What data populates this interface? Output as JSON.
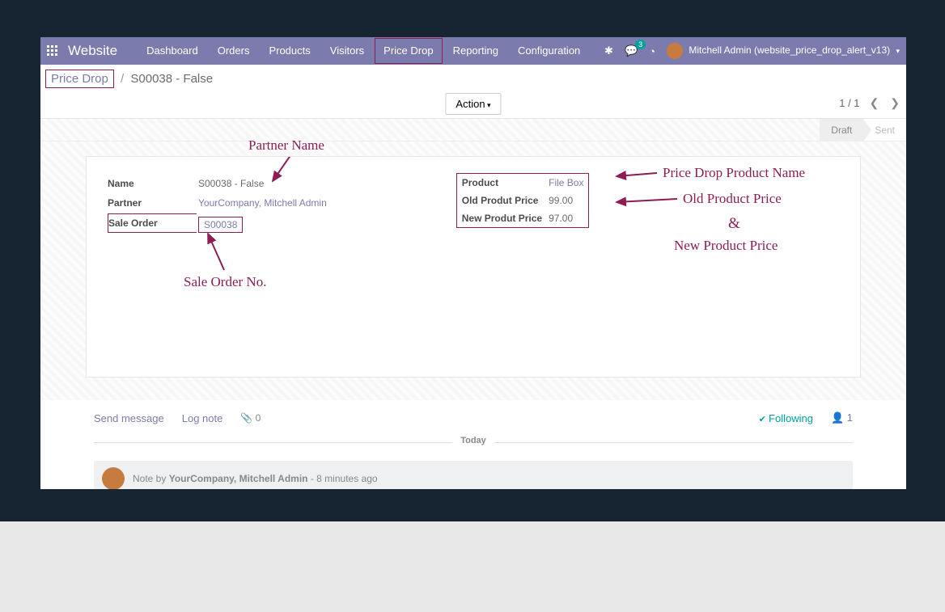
{
  "nav": {
    "brand": "Website",
    "items": [
      "Dashboard",
      "Orders",
      "Products",
      "Visitors",
      "Price Drop",
      "Reporting",
      "Configuration"
    ],
    "active_index": 4,
    "chat_count": "3",
    "user": "Mitchell Admin (website_price_drop_alert_v13)"
  },
  "breadcrumb": {
    "root": "Price Drop",
    "current": "S00038 - False"
  },
  "bar": {
    "action": "Action",
    "pager": "1 / 1"
  },
  "status": {
    "stages": [
      "Draft",
      "Sent"
    ],
    "active_index": 0
  },
  "form": {
    "left": {
      "name_label": "Name",
      "name_value": "S00038 - False",
      "partner_label": "Partner",
      "partner_value": "YourCompany, Mitchell Admin",
      "so_label": "Sale Order",
      "so_value": "S00038"
    },
    "right": {
      "product_label": "Product",
      "product_value": "File Box",
      "old_label": "Old Produt Price",
      "old_value": "99.00",
      "new_label": "New Produt Price",
      "new_value": "97.00"
    }
  },
  "chatter": {
    "send": "Send message",
    "log": "Log note",
    "att": "0",
    "follow": "Following",
    "fcount": "1",
    "today": "Today",
    "note_prefix": "Note by ",
    "note_author": "YourCompany, Mitchell Admin",
    "note_age": " - 8 minutes ago"
  },
  "annotations": {
    "partner": "Partner Name",
    "sale_order": "Sale Order No.",
    "product": "Price Drop Product Name",
    "old": "Old Product Price",
    "amp": "&",
    "new": "New Product Price"
  }
}
